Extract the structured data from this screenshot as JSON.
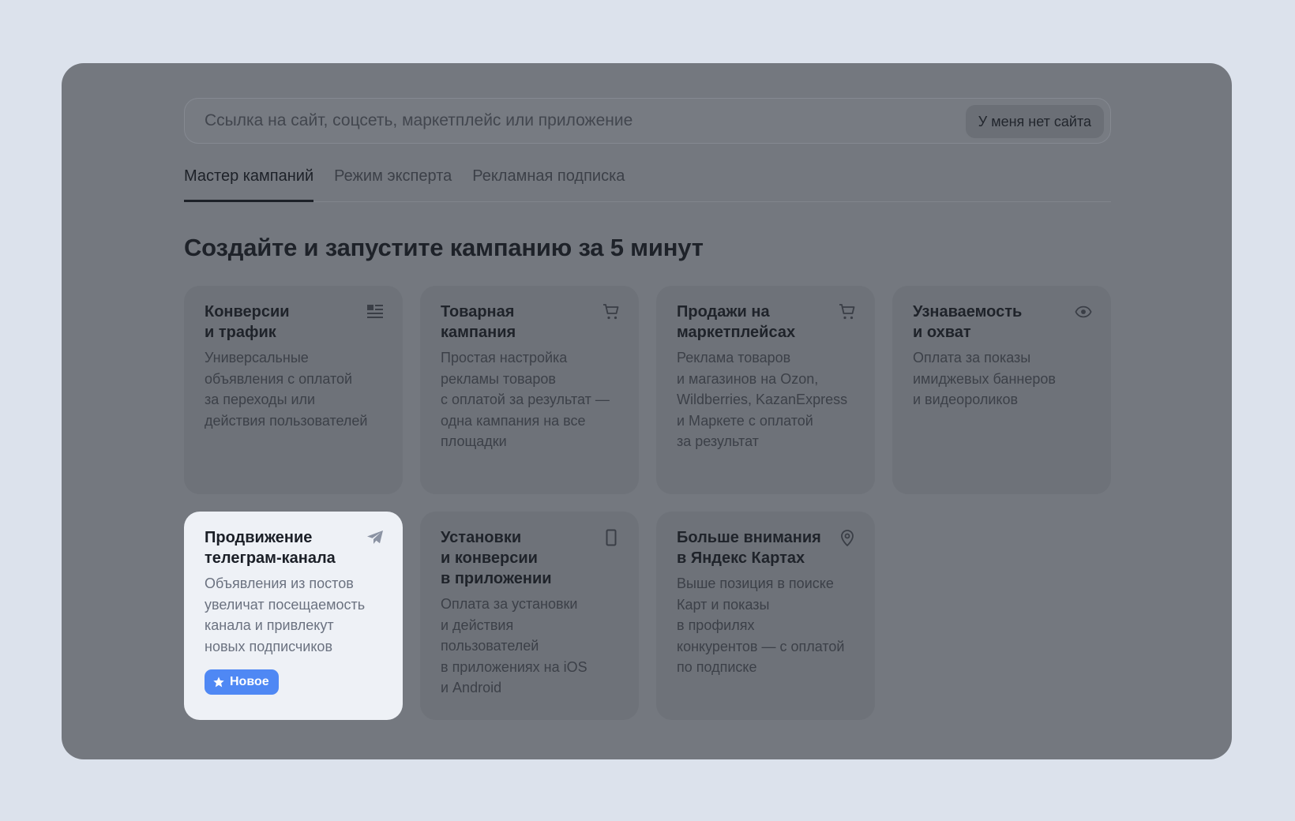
{
  "search": {
    "placeholder": "Ссылка на сайт, соцсеть, маркетплейс или приложение",
    "no_site_label": "У меня нет сайта"
  },
  "tabs": [
    {
      "label": "Мастер кампаний",
      "active": true
    },
    {
      "label": "Режим эксперта",
      "active": false
    },
    {
      "label": "Рекламная подписка",
      "active": false
    }
  ],
  "heading": "Создайте и запустите кампанию за 5 минут",
  "cards": [
    {
      "title": "Конверсии\nи трафик",
      "description": "Универсальные\nобъявления с оплатой\nза переходы или\nдействия пользователей",
      "icon": "list-icon",
      "highlighted": false
    },
    {
      "title": "Товарная\nкампания",
      "description": "Простая настройка\nрекламы товаров\nс оплатой за результат —\nодна кампания на все\nплощадки",
      "icon": "cart-icon",
      "highlighted": false
    },
    {
      "title": "Продажи на\nмаркетплейсах",
      "description": "Реклама товаров\nи магазинов на Ozon,\nWildberries, KazanExpress\nи Маркете с оплатой\nза результат",
      "icon": "cart-icon",
      "highlighted": false
    },
    {
      "title": "Узнаваемость\nи охват",
      "description": "Оплата за показы\nимиджевых баннеров\nи видеороликов",
      "icon": "eye-icon",
      "highlighted": false
    },
    {
      "title": "Продвижение\nтелеграм-канала",
      "description": "Объявления из постов\nувеличат посещаемость\nканала и привлекут\nновых подписчиков",
      "icon": "telegram-icon",
      "highlighted": true,
      "badge": "Новое"
    },
    {
      "title": "Установки\nи конверсии\nв приложении",
      "description": "Оплата за установки\nи действия\nпользователей\nв приложениях на iOS\nи Android",
      "icon": "phone-icon",
      "highlighted": false
    },
    {
      "title": "Больше внимания\nв Яндекс Картах",
      "description": "Выше позиция в поиске\nКарт и показы\nв профилях\nконкурентов — с оплатой\nпо подписке",
      "icon": "map-pin-icon",
      "highlighted": false
    }
  ],
  "colors": {
    "page_background": "#dce2ec",
    "panel_overlay": "#74787f",
    "card_dimmed": "#6e7279",
    "card_highlight": "#eef1f6",
    "badge_accent": "#4f88f4"
  }
}
